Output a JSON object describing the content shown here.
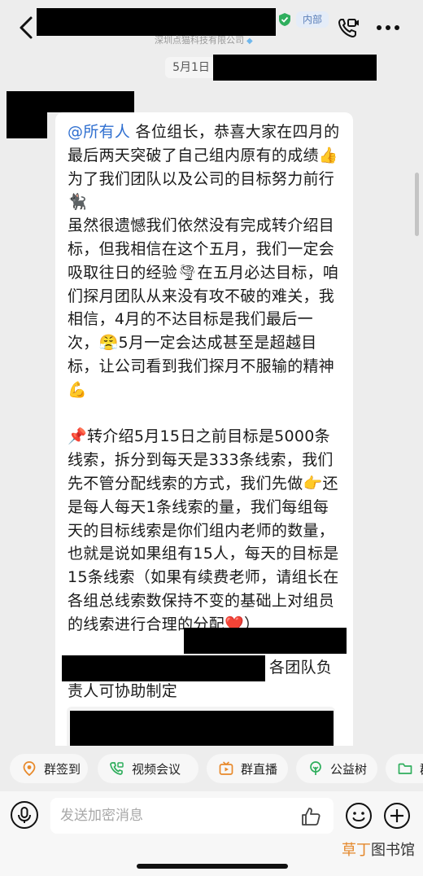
{
  "header": {
    "badge": "内部",
    "company": "深圳点猫科技有限公司"
  },
  "chat": {
    "date": "5月1日",
    "mention": "@所有人",
    "paragraphs": [
      " 各位组长，恭喜大家在四月的最后两天突破了自己组内原有的成绩👍为了我们团队以及公司的目标努力前行🐈‍⬛",
      "虽然很遗憾我们依然没有完成转介绍目标，但我相信在这个五月，我们一定会吸取往日的经验🌪在五月必达目标，咱们探月团队从来没有攻不破的难关，我相信，4月的不达目标是我们最后一次，😤5月一定会达成甚至是超越目标，让公司看到我们探月不服输的精神💪",
      "",
      "📌转介绍5月15日之前目标是5000条线索，拆分到每天是333条线索，我们先不管分配线索的方式，我们先做👉还是每人每天1条线索的量，我们每组每天的目标线索是你们组内老师的数量，也就是说如果组有15人，每天的目标是15条线索（如果有续费老师，请组长在各组总线索数保持不变的基础上对组员的线索进行合理的分配❤️）"
    ],
    "tail_visible": "各团队负责人可协助制定",
    "quote_emoji": "👌"
  },
  "tools": [
    {
      "label": "群签到",
      "icon": "checkin-icon",
      "color": "#e8892a"
    },
    {
      "label": "视频会议",
      "icon": "video-meeting-icon",
      "color": "#2fae5d"
    },
    {
      "label": "群直播",
      "icon": "live-icon",
      "color": "#e8892a"
    },
    {
      "label": "公益树",
      "icon": "charity-tree-icon",
      "color": "#2fae5d"
    },
    {
      "label": "群",
      "icon": "folder-icon",
      "color": "#2fae5d"
    }
  ],
  "input": {
    "placeholder": "发送加密消息"
  },
  "watermark": {
    "orange": "草丁",
    "dark": "图书馆"
  }
}
